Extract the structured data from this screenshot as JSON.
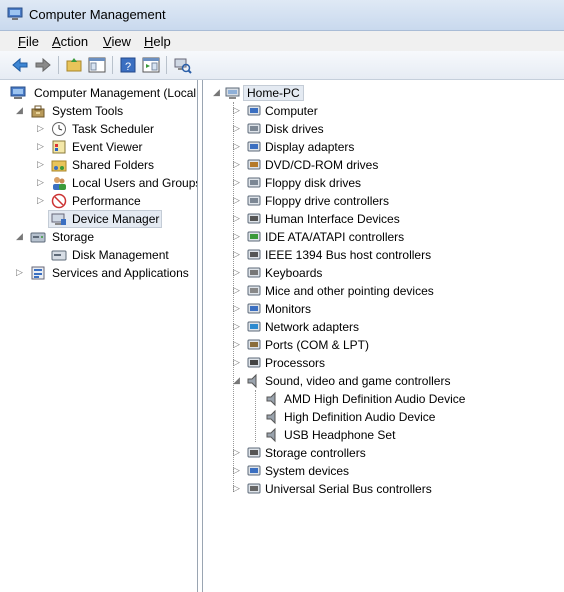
{
  "window": {
    "title": "Computer Management"
  },
  "menu": [
    {
      "first": "F",
      "rest": "ile"
    },
    {
      "first": "A",
      "rest": "ction"
    },
    {
      "first": "V",
      "rest": "iew"
    },
    {
      "first": "H",
      "rest": "elp"
    }
  ],
  "toolbar": {
    "icons": [
      "back-arrow-icon",
      "forward-arrow-icon",
      "up-folder-icon",
      "show-hide-tree-icon",
      "help-icon",
      "action-pane-icon",
      "scan-hardware-icon"
    ]
  },
  "left_tree": {
    "root": "Computer Management (Local",
    "system_tools": "System Tools",
    "task_scheduler": "Task Scheduler",
    "event_viewer": "Event Viewer",
    "shared_folders": "Shared Folders",
    "local_users": "Local Users and Groups",
    "performance": "Performance",
    "device_manager": "Device Manager",
    "storage": "Storage",
    "disk_management": "Disk Management",
    "services": "Services and Applications"
  },
  "device_tree": {
    "root": "Home-PC",
    "categories": [
      "Computer",
      "Disk drives",
      "Display adapters",
      "DVD/CD-ROM drives",
      "Floppy disk drives",
      "Floppy drive controllers",
      "Human Interface Devices",
      "IDE ATA/ATAPI controllers",
      "IEEE 1394 Bus host controllers",
      "Keyboards",
      "Mice and other pointing devices",
      "Monitors",
      "Network adapters",
      "Ports (COM & LPT)",
      "Processors",
      "Sound, video and game controllers"
    ],
    "sound_children": [
      "AMD High Definition Audio Device",
      "High Definition Audio Device",
      "USB Headphone Set"
    ],
    "after": [
      "Storage controllers",
      "System devices",
      "Universal Serial Bus controllers"
    ]
  }
}
